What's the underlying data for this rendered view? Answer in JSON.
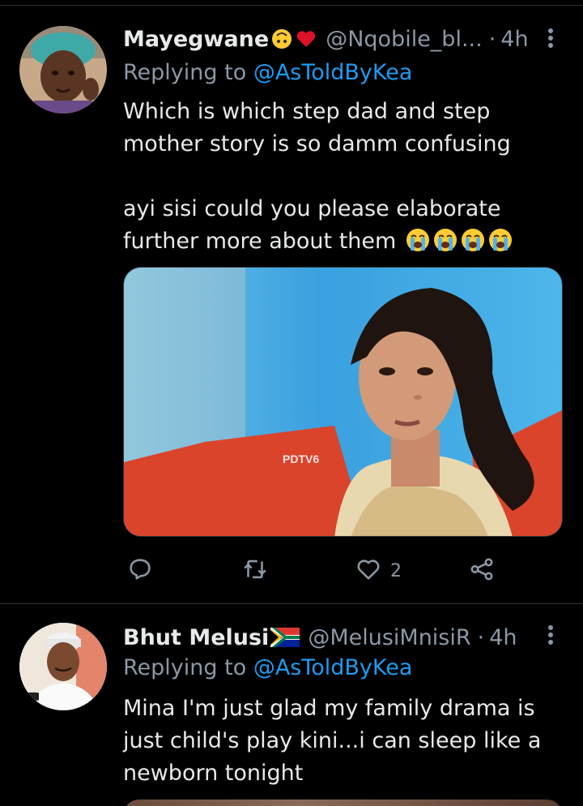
{
  "tweets": [
    {
      "display_name": "Mayegwane",
      "name_emojis": [
        "upside-down-face-icon",
        "red-heart-icon"
      ],
      "handle": "@Nqobile_bl...",
      "separator": "·",
      "time": "4h",
      "replying_prefix": "Replying to",
      "replying_handle": "@AsToldByKea",
      "text_para1_line1": "Which is which step dad and step",
      "text_para1_line2": "mother story is so damm confusing",
      "text_para2_line1": "ayi sisi could you please elaborate",
      "text_para2_line2": "further more about them",
      "text_emojis": [
        "loudly-crying-face-icon",
        "loudly-crying-face-icon",
        "loudly-crying-face-icon",
        "loudly-crying-face-icon"
      ],
      "media_watermark": "PDTV6",
      "like_count": "2"
    },
    {
      "display_name": "Bhut Melusi",
      "name_emojis": [
        "south-africa-flag-icon"
      ],
      "handle": "@MelusiMnisiR",
      "separator": "·",
      "time": "4h",
      "replying_prefix": "Replying to",
      "replying_handle": "@AsToldByKea",
      "text_line1": "Mina I'm just glad my family drama is",
      "text_line2": "just child's play kini...i can sleep like a",
      "text_line3": "newborn tonight"
    }
  ],
  "colors": {
    "background": "#000000",
    "text": "#e7e9ea",
    "muted": "#8b98a5",
    "link": "#1d9bf0",
    "divider": "#2f3336"
  }
}
